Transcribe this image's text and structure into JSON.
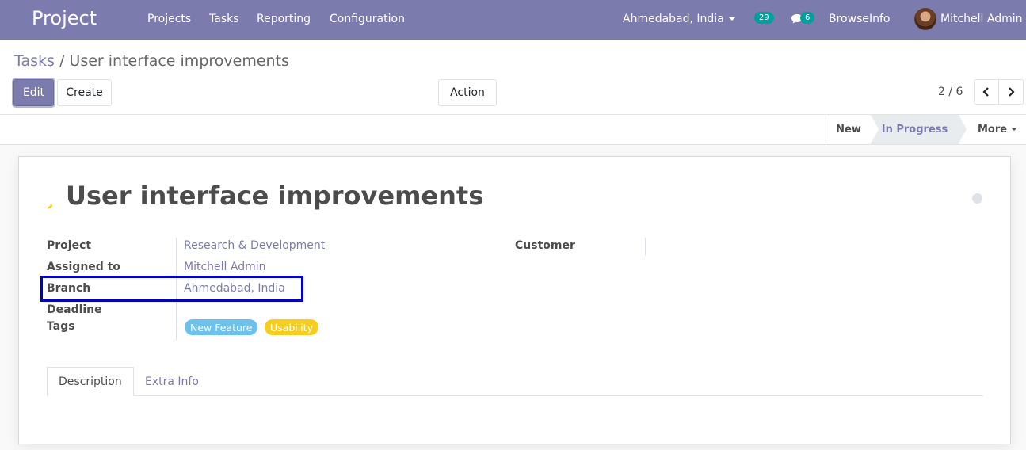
{
  "navbar": {
    "app_name": "Project",
    "menus": [
      "Projects",
      "Tasks",
      "Reporting",
      "Configuration"
    ],
    "company": "Ahmedabad, India",
    "activity_count": "29",
    "message_count": "6",
    "database": "BrowseInfo",
    "user": "Mitchell Admin"
  },
  "breadcrumb": {
    "parent": "Tasks",
    "separator": "/",
    "current": "User interface improvements"
  },
  "toolbar": {
    "edit_label": "Edit",
    "create_label": "Create",
    "action_label": "Action",
    "pager": "2 / 6"
  },
  "statusbar": {
    "stages": [
      "New",
      "In Progress"
    ],
    "active_stage": "In Progress",
    "more_label": "More"
  },
  "form": {
    "title": "User interface improvements",
    "fields": {
      "project_label": "Project",
      "project_value": "Research & Development",
      "assigned_label": "Assigned to",
      "assigned_value": "Mitchell Admin",
      "branch_label": "Branch",
      "branch_value": "Ahmedabad, India",
      "deadline_label": "Deadline",
      "tags_label": "Tags",
      "customer_label": "Customer"
    },
    "tags": [
      {
        "name": "New Feature",
        "color": "#6cc1ed"
      },
      {
        "name": "Usability",
        "color": "#f7cd1f"
      }
    ],
    "tabs": [
      "Description",
      "Extra Info"
    ]
  },
  "colors": {
    "brand": "#7c7bad",
    "highlight": "#0000c8"
  }
}
